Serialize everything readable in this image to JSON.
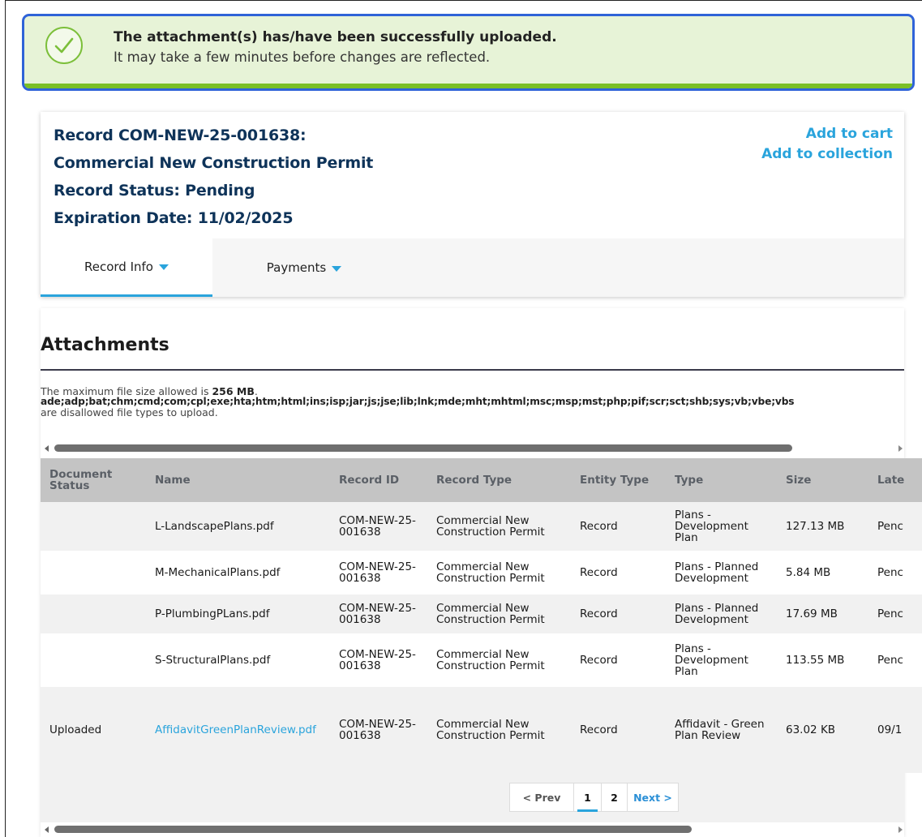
{
  "banner": {
    "title": "The attachment(s) has/have been successfully uploaded.",
    "subtitle": "It may take a few minutes before changes are reflected.",
    "icon": "check-circle-icon",
    "border_color": "#2f63d8",
    "accent_color": "#7abf26"
  },
  "record": {
    "line1": "Record COM-NEW-25-001638:",
    "line2": "Commercial New Construction Permit",
    "line3": "Record Status: Pending",
    "line4": "Expiration Date: 11/02/2025",
    "add_to_cart": "Add to cart",
    "add_to_collection": "Add to collection"
  },
  "tabs": [
    {
      "label": "Record Info",
      "active": true
    },
    {
      "label": "Payments",
      "active": false
    }
  ],
  "attachments": {
    "title": "Attachments",
    "max_size_prefix": "The maximum file size allowed is ",
    "max_size_value": "256 MB",
    "max_size_suffix": ".",
    "disallowed_types": "ade;adp;bat;chm;cmd;com;cpl;exe;hta;htm;html;ins;isp;jar;js;jse;lib;lnk;mde;mht;mhtml;msc;msp;mst;php;pif;scr;sct;shb;sys;vb;vbe;vbs",
    "disallowed_note": "are disallowed file types to upload.",
    "columns": [
      "Document Status",
      "Name",
      "Record ID",
      "Record Type",
      "Entity Type",
      "Type",
      "Size",
      "Late"
    ],
    "rows": [
      {
        "status": "",
        "name": "L-LandscapePlans.pdf",
        "record_id": "COM-NEW-25-001638",
        "record_type": "Commercial New Construction Permit",
        "entity": "Record",
        "type": "Plans - Development Plan",
        "size": "127.13 MB",
        "latest": "Penc"
      },
      {
        "status": "",
        "name": "M-MechanicalPlans.pdf",
        "record_id": "COM-NEW-25-001638",
        "record_type": "Commercial New Construction Permit",
        "entity": "Record",
        "type": "Plans - Planned Development",
        "size": "5.84 MB",
        "latest": "Penc"
      },
      {
        "status": "",
        "name": "P-PlumbingPLans.pdf",
        "record_id": "COM-NEW-25-001638",
        "record_type": "Commercial New Construction Permit",
        "entity": "Record",
        "type": "Plans - Planned Development",
        "size": "17.69 MB",
        "latest": "Penc"
      },
      {
        "status": "",
        "name": "S-StructuralPlans.pdf",
        "record_id": "COM-NEW-25-001638",
        "record_type": "Commercial New Construction Permit",
        "entity": "Record",
        "type": "Plans - Development Plan",
        "size": "113.55 MB",
        "latest": "Penc"
      },
      {
        "status": "Uploaded",
        "name": "AffidavitGreenPlanReview.pdf",
        "record_id": "COM-NEW-25-001638",
        "record_type": "Commercial New Construction Permit",
        "entity": "Record",
        "type": "Affidavit - Green Plan Review",
        "size": "63.02 KB",
        "latest": "09/1"
      }
    ]
  },
  "pager": {
    "prev": "< Prev",
    "page1": "1",
    "page2": "2",
    "next": "Next >"
  }
}
